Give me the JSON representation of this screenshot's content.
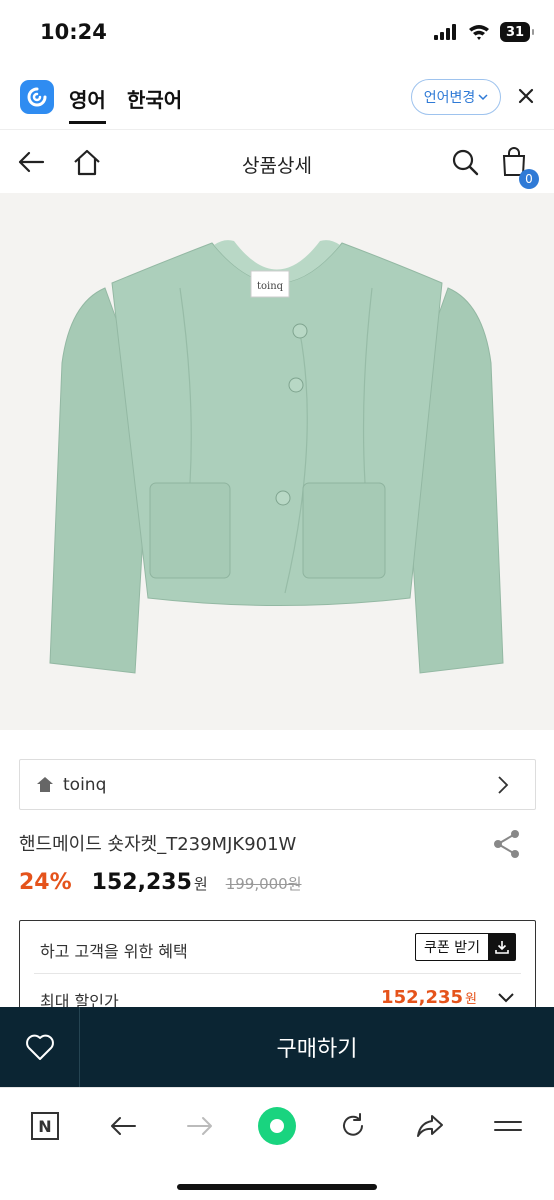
{
  "status_bar": {
    "time": "10:24",
    "battery": "31"
  },
  "lang_bar": {
    "tab_active": "영어",
    "tab_second": "한국어",
    "change_label": "언어변경"
  },
  "nav": {
    "title": "상품상세",
    "cart_count": "0"
  },
  "product": {
    "image_label": "toinq",
    "brand": "toinq",
    "name": "핸드메이드 숏자켓_T239MJK901W",
    "discount_rate": "24%",
    "sale_price": "152,235",
    "currency": "원",
    "original_price": "199,000원"
  },
  "benefit": {
    "title": "하고 고객을 위한 혜택",
    "coupon_label": "쿠폰 받기",
    "max_label": "최대 할인가",
    "max_price": "152,235",
    "max_currency": "원"
  },
  "buy_bar": {
    "buy_label": "구매하기"
  },
  "browser": {
    "n_label": "N"
  },
  "colors": {
    "accent": "#e5531b",
    "buy_bar": "#0b2533",
    "link": "#2f7ad6",
    "jacket": "#a9cdb8",
    "browser_green": "#19d47f"
  }
}
